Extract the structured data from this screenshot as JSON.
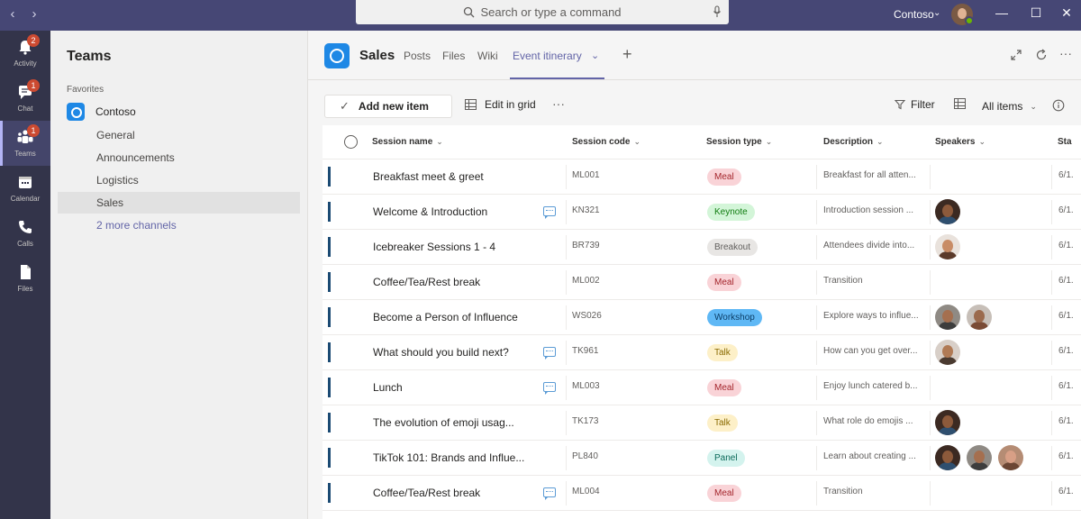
{
  "topbar": {
    "search_placeholder": "Search or type a command",
    "org": "Contoso"
  },
  "appbar": [
    {
      "label": "Activity",
      "badge": "2",
      "icon": "bell-icon"
    },
    {
      "label": "Chat",
      "badge": "1",
      "icon": "chat-icon"
    },
    {
      "label": "Teams",
      "badge": "1",
      "icon": "teams-icon"
    },
    {
      "label": "Calendar",
      "badge": "",
      "icon": "calendar-icon"
    },
    {
      "label": "Calls",
      "badge": "",
      "icon": "phone-icon"
    },
    {
      "label": "Files",
      "badge": "",
      "icon": "file-icon"
    }
  ],
  "teams_panel": {
    "title": "Teams",
    "favorites_label": "Favorites",
    "team": "Contoso",
    "channels": [
      "General",
      "Announcements",
      "Logistics",
      "Sales"
    ],
    "more_channels": "2 more channels"
  },
  "header": {
    "channel": "Sales",
    "tabs": [
      "Posts",
      "Files",
      "Wiki",
      "Event itinerary"
    ]
  },
  "command_bar": {
    "add_new": "Add new item",
    "edit_grid": "Edit in grid",
    "more": "···",
    "filter": "Filter",
    "view": "All items"
  },
  "table": {
    "columns": [
      "Session name",
      "Session code",
      "Session type",
      "Description",
      "Speakers",
      "Sta"
    ],
    "rows": [
      {
        "name": "Breakfast meet & greet",
        "code": "ML001",
        "type": "Meal",
        "desc": "Breakfast for all atten...",
        "start": "6/1.",
        "chat": false,
        "speakers": []
      },
      {
        "name": "Welcome & Introduction",
        "code": "KN321",
        "type": "Keynote",
        "desc": "Introduction session ...",
        "start": "6/1.",
        "chat": true,
        "speakers": [
          "a"
        ]
      },
      {
        "name": "Icebreaker Sessions 1 - 4",
        "code": "BR739",
        "type": "Breakout",
        "desc": "Attendees divide into...",
        "start": "6/1.",
        "chat": false,
        "speakers": [
          "b"
        ]
      },
      {
        "name": "Coffee/Tea/Rest break",
        "code": "ML002",
        "type": "Meal",
        "desc": "Transition",
        "start": "6/1.",
        "chat": false,
        "speakers": []
      },
      {
        "name": "Become a Person of Influence",
        "code": "WS026",
        "type": "Workshop",
        "desc": "Explore ways to influe...",
        "start": "6/1.",
        "chat": false,
        "speakers": [
          "c",
          "d"
        ]
      },
      {
        "name": "What should you build next?",
        "code": "TK961",
        "type": "Talk",
        "desc": "How can you get over...",
        "start": "6/1.",
        "chat": true,
        "speakers": [
          "e"
        ]
      },
      {
        "name": "Lunch",
        "code": "ML003",
        "type": "Meal",
        "desc": "Enjoy lunch catered b...",
        "start": "6/1.",
        "chat": true,
        "speakers": []
      },
      {
        "name": "The evolution of emoji usag...",
        "code": "TK173",
        "type": "Talk",
        "desc": "What role do emojis ...",
        "start": "6/1.",
        "chat": false,
        "speakers": [
          "a"
        ]
      },
      {
        "name": "TikTok 101: Brands and Influe...",
        "code": "PL840",
        "type": "Panel",
        "desc": "Learn about creating ...",
        "start": "6/1.",
        "chat": false,
        "speakers": [
          "a",
          "c",
          "f"
        ]
      },
      {
        "name": "Coffee/Tea/Rest break",
        "code": "ML004",
        "type": "Meal",
        "desc": "Transition",
        "start": "6/1.",
        "chat": true,
        "speakers": []
      }
    ]
  },
  "colors": {
    "topbar": "#464775",
    "appbar": "#33344a",
    "accent": "#6264a7",
    "meal": "#f9d3d7",
    "keynote": "#d3f5d8",
    "breakout": "#e8e6e4",
    "workshop": "#5fb8f5",
    "talk": "#fdf0c8",
    "panel": "#d4f3ee"
  }
}
